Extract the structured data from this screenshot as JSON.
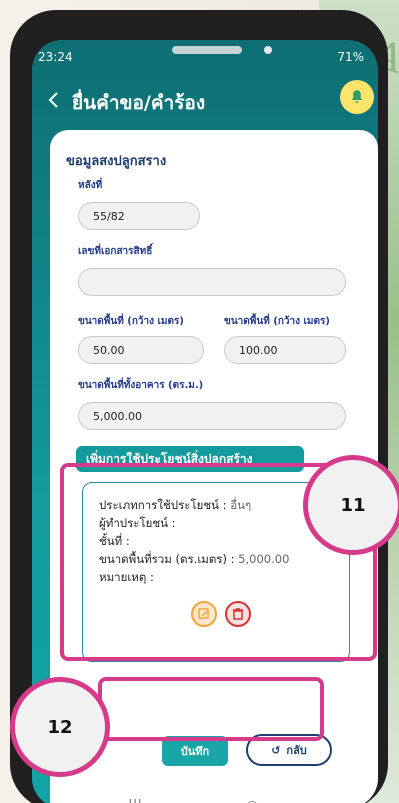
{
  "status": {
    "time": "23:24",
    "battery": "71%"
  },
  "header": {
    "title": "ยื่นคำขอ/คำร้อง"
  },
  "section": {
    "title": "ขอมูลสงปลูกสราง"
  },
  "fields": {
    "house_no": {
      "label": "หลังที่",
      "value": "55/82"
    },
    "title_deed": {
      "label": "เลขที่เอกสารสิทธิ์",
      "value": ""
    },
    "width": {
      "label": "ขนาดพื้นที่ (กว้าง เมตร)",
      "value": "50.00"
    },
    "length": {
      "label": "ขนาดพื้นที่ (กว้าง เมตร)",
      "value": "100.00"
    },
    "total_area": {
      "label": "ขนาดพื้นที่ทั้งอาคาร (ตร.ม.)",
      "value": "5,000.00"
    }
  },
  "add_usage_label": "เพิ่มการใช้ประโยชน์สิ่งปลูกสร้าง",
  "usage": {
    "type_label": "ประเภทการใช้ประโยชน์ :",
    "type_value": "อื่นๆ",
    "user_label": "ผู้ทำประโยชน์ :",
    "floor_label": "ชั้นที่ :",
    "total_label": "ขนาดพื้นที่รวม (ตร.เมตร) :",
    "total_value": "5,000.00",
    "note_label": "หมายเหตุ :"
  },
  "buttons": {
    "save": "บันทึก",
    "back": "กลับ"
  },
  "callouts": {
    "c11": "11",
    "c12": "12"
  },
  "nav": {
    "recent": "|||",
    "home": "○",
    "back": "‹"
  }
}
